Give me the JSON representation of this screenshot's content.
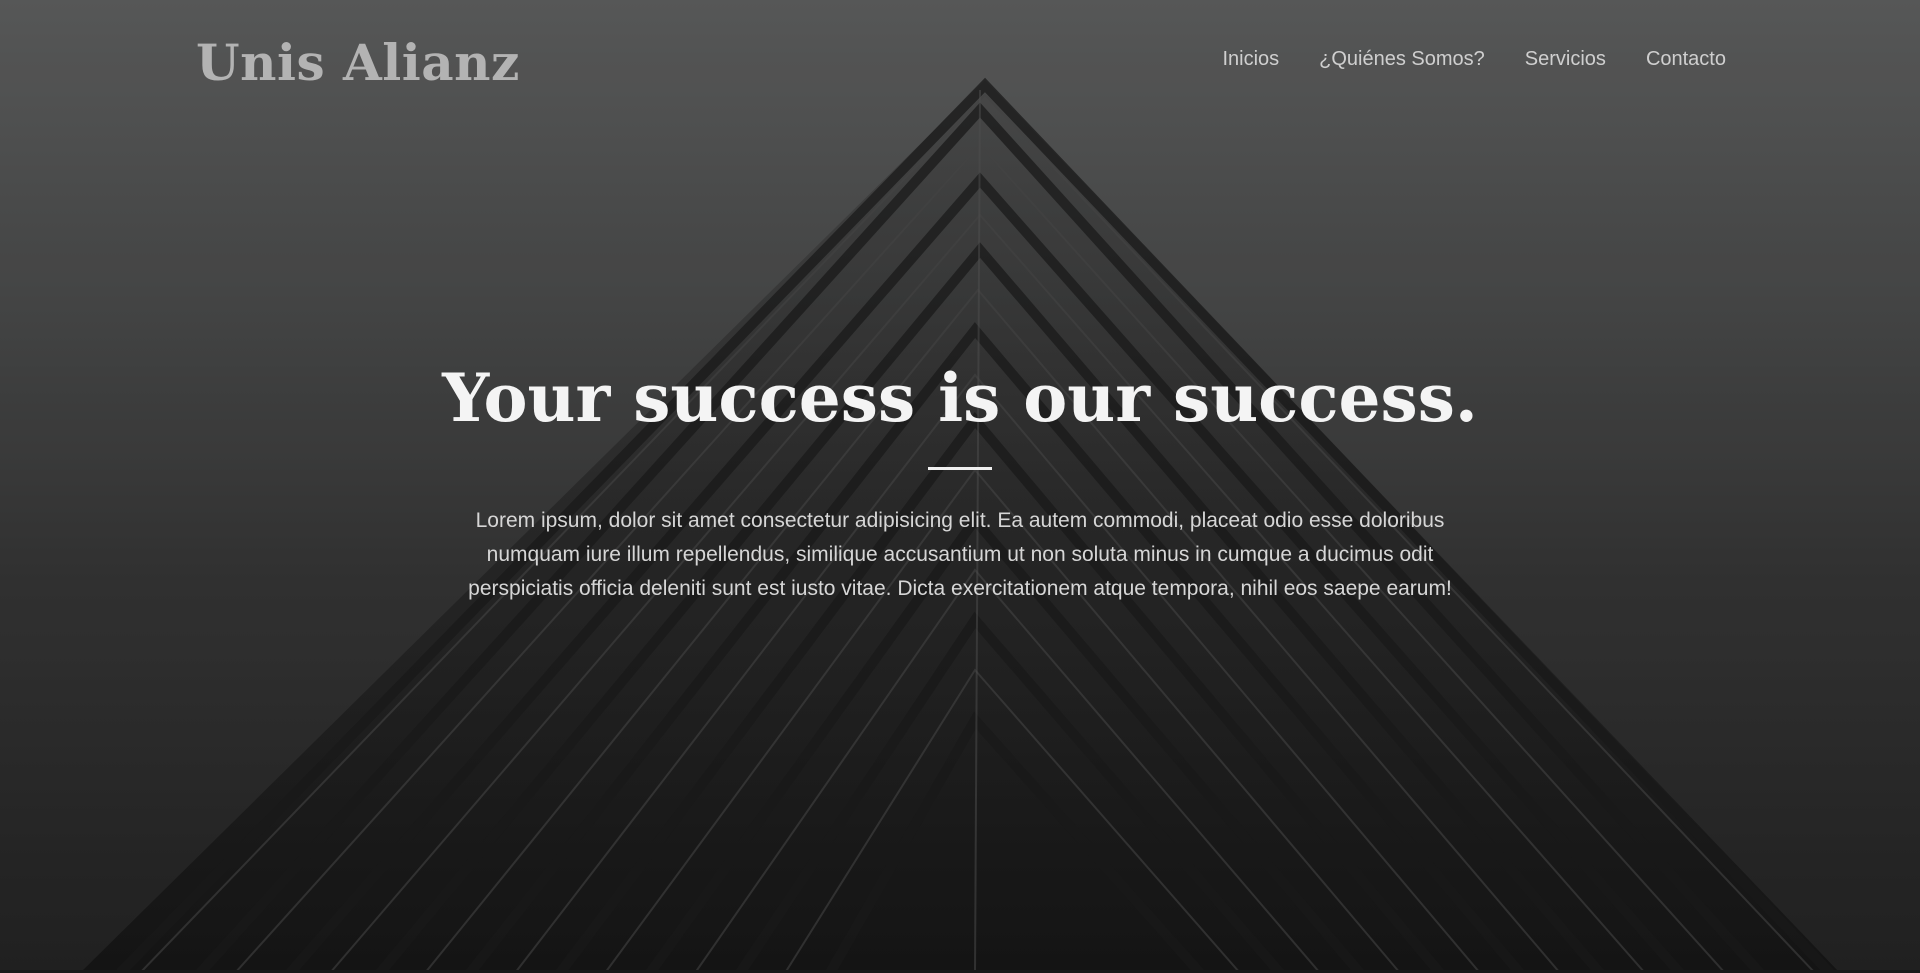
{
  "brand": {
    "logo_text": "Unis Alianz"
  },
  "nav": {
    "items": [
      {
        "label": "Inicios"
      },
      {
        "label": "¿Quiénes Somos?"
      },
      {
        "label": "Servicios"
      },
      {
        "label": "Contacto"
      }
    ]
  },
  "hero": {
    "headline": "Your success is our success.",
    "paragraph": "Lorem ipsum, dolor sit amet consectetur adipisicing elit. Ea autem commodi, placeat odio esse doloribus numquam iure illum repellendus, similique accusantium ut non soluta minus in cumque a ducimus odit perspiciatis officia deleniti sunt est iusto vitae. Dicta exercitationem atque tempora, nihil eos saepe earum!",
    "background_image": "building-corner-photo"
  },
  "colors": {
    "logo": "#b3b3b3",
    "nav_text": "#cfcfcf",
    "headline": "#f4f4f4",
    "body_text": "#d6d6d6",
    "divider": "#f0f0f0"
  }
}
